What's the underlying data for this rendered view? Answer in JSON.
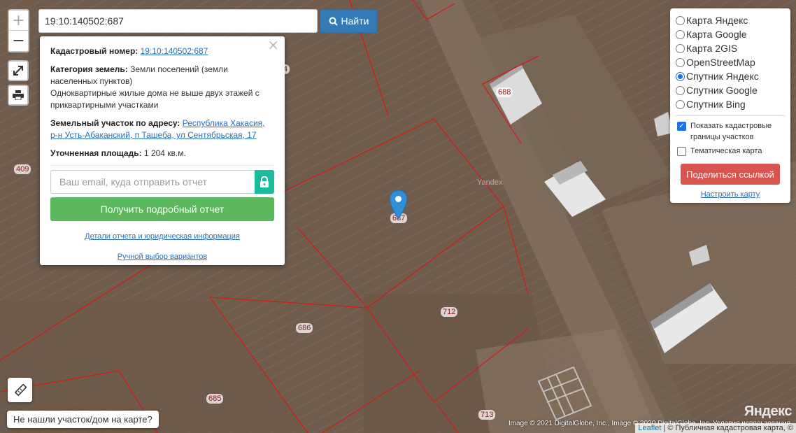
{
  "search": {
    "value": "19:10:140502:687",
    "button_label": "Найти"
  },
  "zoom": {
    "in_label": "+",
    "out_label": "−"
  },
  "popup": {
    "close_label": "×",
    "cadastral_label": "Кадастровый номер:",
    "cadastral_value": "19:10:140502:687",
    "category_label": "Категория земель:",
    "category_value": "Земли поселений (земли населенных пунктов)",
    "usage_value": "Одноквартирные жилые дома не выше двух этажей с приквартирными участками",
    "address_label": "Земельный участок по адресу:",
    "address_value_line1": "Республика Хакасия,",
    "address_value_line2": "р-н Усть-Абаканский, п Ташеба, ул Сентябрьская, 17",
    "area_label": "Уточненная площадь:",
    "area_value": "1 204 кв.м.",
    "email_placeholder": "Ваш email, куда отправить отчет",
    "report_button": "Получить подробный отчет",
    "details_link": "Детали отчета и юридическая информация",
    "manual_link": "Ручной выбор вариантов"
  },
  "layers": {
    "options": [
      {
        "label": "Карта Яндекс",
        "selected": false
      },
      {
        "label": "Карта Google",
        "selected": false
      },
      {
        "label": "Карта 2GIS",
        "selected": false
      },
      {
        "label": "OpenStreetMap",
        "selected": false
      },
      {
        "label": "Спутник Яндекс",
        "selected": true
      },
      {
        "label": "Спутник Google",
        "selected": false
      },
      {
        "label": "Спутник Bing",
        "selected": false
      }
    ],
    "show_borders_label": "Показать кадастровые границы участков",
    "show_borders_checked": true,
    "thematic_label": "Тематическая карта",
    "thematic_checked": false,
    "share_button": "Поделиться ссылкой",
    "configure_link": "Настроить карту"
  },
  "map": {
    "parcel_labels": [
      "409",
      "4",
      "688",
      "687",
      "712",
      "686",
      "685",
      "713"
    ],
    "yandex_watermark": "Yandex",
    "yandex_logo": "Яндекс",
    "imagery_credit": "Image © 2021 DigitalGlobe, Inc., Image © 2020 DigitalGlobe, Inc. Условия использования",
    "attribution_leaflet": "Leaflet",
    "attribution_separator": "|",
    "attribution_source": "© Публичная кадастровая карта, ©"
  },
  "bottom": {
    "not_found_button": "Не нашли участок/дом на карте?"
  },
  "colors": {
    "parcel_border": "#d41a1a",
    "search_button": "#337ab7",
    "report_button": "#5cb85c",
    "share_button": "#d9534f",
    "lock_button": "#1abc9c",
    "marker": "#2f8fd8"
  }
}
